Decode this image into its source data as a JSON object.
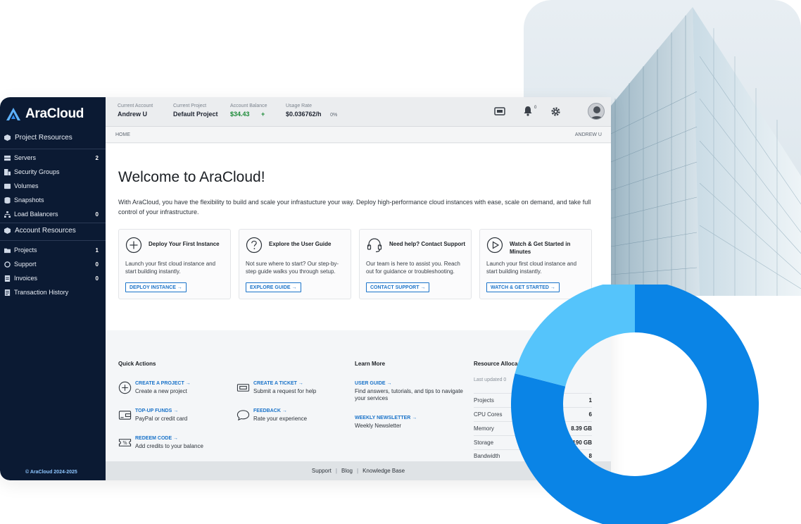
{
  "brand": {
    "name": "AraCloud",
    "copyright": "© AraCloud 2024-2025"
  },
  "sidebar": {
    "project_section": "Project Resources",
    "project_items": [
      {
        "label": "Servers",
        "count": "2"
      },
      {
        "label": "Security Groups",
        "count": ""
      },
      {
        "label": "Volumes",
        "count": ""
      },
      {
        "label": "Snapshots",
        "count": ""
      },
      {
        "label": "Load Balancers",
        "count": "0"
      }
    ],
    "account_section": "Account Resources",
    "account_items": [
      {
        "label": "Projects",
        "count": "1"
      },
      {
        "label": "Support",
        "count": "0"
      },
      {
        "label": "Invoices",
        "count": "0"
      },
      {
        "label": "Transaction History",
        "count": ""
      }
    ]
  },
  "header": {
    "account_label": "Current Account",
    "account_value": "Andrew U",
    "project_label": "Current Project",
    "project_value": "Default Project",
    "balance_label": "Account Balance",
    "balance_value": "$34.43",
    "balance_plus": "+",
    "usage_label": "Usage Rate",
    "usage_value": "$0.036762/h",
    "usage_percent": "0%",
    "notification_count": "0"
  },
  "breadcrumb": {
    "home": "HOME",
    "user": "ANDREW U"
  },
  "welcome": {
    "title": "Welcome to AraCloud!",
    "intro": "With AraCloud, you have the flexibility to build and scale your infrastucture your way. Deploy high-performance cloud instances with ease, scale on demand, and take full control of your infrastructure."
  },
  "cards": [
    {
      "title": "Deploy Your First Instance",
      "desc": "Launch your first cloud instance and start building instantly.",
      "button": "DEPLOY INSTANCE →"
    },
    {
      "title": "Explore the User Guide",
      "desc": "Not sure where to start? Our step-by-step guide walks you through setup.",
      "button": "EXPLORE GUIDE →"
    },
    {
      "title": "Need help? Contact Support",
      "desc": "Our team is here to assist you. Reach out for guidance or troubleshooting.",
      "button": "CONTACT SUPPORT →"
    },
    {
      "title": "Watch & Get Started in Minutes",
      "desc": "Launch your first cloud instance and start building instantly.",
      "button": "WATCH & GET STARTED →"
    }
  ],
  "quick_actions": {
    "title": "Quick Actions",
    "items": [
      {
        "link": "CREATE A PROJECT →",
        "desc": "Create a new project"
      },
      {
        "link": "TOP-UP FUNDS →",
        "desc": "PayPal or credit card"
      },
      {
        "link": "REDEEM CODE →",
        "desc": "Add credits to your balance"
      },
      {
        "link": "CREATE A TICKET →",
        "desc": "Submit a request for help"
      },
      {
        "link": "FEEDBACK →",
        "desc": "Rate your experience"
      }
    ]
  },
  "learn_more": {
    "title": "Learn More",
    "items": [
      {
        "link": "USER GUIDE →",
        "desc": "Find answers, tutorials, and tips to navigate your services"
      },
      {
        "link": "WEEKLY NEWSLETTER →",
        "desc": "Weekly Newsletter"
      }
    ]
  },
  "resources": {
    "title": "Resource Alloca",
    "updated": "Last updated 0",
    "rows": [
      {
        "label": "Projects",
        "value": "1"
      },
      {
        "label": "CPU Cores",
        "value": "6"
      },
      {
        "label": "Memory",
        "value": "8.39 GB"
      },
      {
        "label": "Storage",
        "value": "190 GB"
      },
      {
        "label": "Bandwidth",
        "value": "8"
      }
    ]
  },
  "footer": {
    "links": [
      "Support",
      "Blog",
      "Knowledge Base"
    ]
  },
  "donut": {
    "segments": [
      {
        "fraction": 0.79,
        "color": "#0a84e6"
      },
      {
        "fraction": 0.21,
        "color": "#55c4fb"
      }
    ]
  }
}
